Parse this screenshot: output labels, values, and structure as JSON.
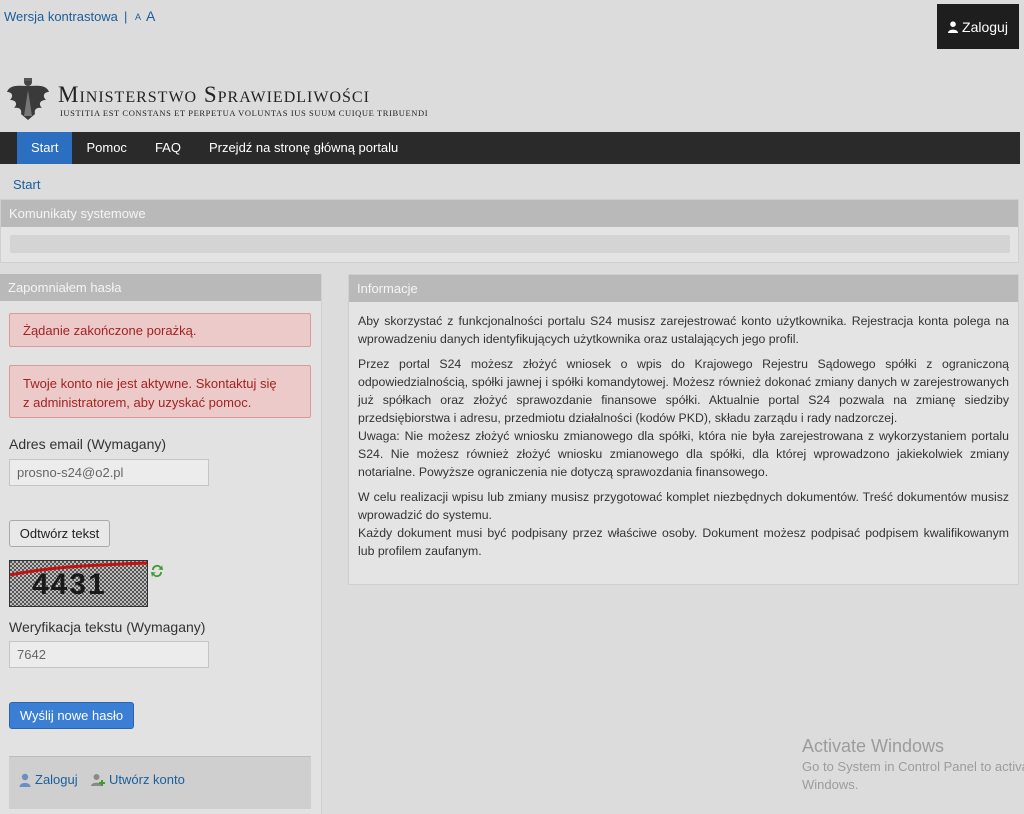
{
  "top": {
    "contrast": "Wersja kontrastowa",
    "separator": "|",
    "font_small": "A",
    "font_large": "A",
    "login": "Zaloguj"
  },
  "logo": {
    "title": "Ministerstwo Sprawiedliwości",
    "motto": "IUSTITIA EST CONSTANS ET PERPETUA VOLUNTAS IUS SUUM CUIQUE TRIBUENDI"
  },
  "nav": [
    "Start",
    "Pomoc",
    "FAQ",
    "Przejdź na stronę główną portalu"
  ],
  "breadcrumb": "Start",
  "system_panel": {
    "title": "Komunikaty systemowe"
  },
  "left_panel": {
    "title": "Zapomniałem hasła",
    "alert1": "Żądanie zakończone porażką.",
    "alert2_line1": "Twoje konto nie jest aktywne. Skontaktuj się",
    "alert2_line2": "z administratorem, aby uzyskać pomoc.",
    "email_label": "Adres email (Wymagany)",
    "email_value": "prosno-s24@o2.pl",
    "audio_button": "Odtwórz tekst",
    "captcha_label": "Weryfikacja tekstu (Wymagany)",
    "captcha_value": "7642",
    "submit": "Wyślij nowe hasło",
    "footer_login": "Zaloguj",
    "footer_register": "Utwórz konto"
  },
  "info_panel": {
    "title": "Informacje",
    "p1": "Aby skorzystać z funkcjonalności portalu S24 musisz zarejestrować konto użytkownika. Rejestracja konta polega na wprowadzeniu danych identyfikujących użytkownika oraz ustalających jego profil.",
    "p2a": "Przez portal S24 możesz złożyć wniosek o wpis do Krajowego Rejestru Sądowego spółki z ograniczoną odpowiedzialnością, spółki jawnej i spółki komandytowej. Możesz również dokonać zmiany danych w zarejestrowanych już spółkach oraz złożyć sprawozdanie finansowe spółki. Aktualnie portal S24 pozwala na zmianę siedziby przedsiębiorstwa i adresu, przedmiotu działalności (kodów PKD), składu zarządu i rady nadzorczej.",
    "p2b": "Uwaga: Nie możesz złożyć wniosku zmianowego dla spółki, która nie była zarejestrowana z wykorzystaniem portalu S24. Nie możesz również złożyć wniosku zmianowego dla spółki, dla której wprowadzono jakiekolwiek zmiany notarialne. Powyższe ograniczenia nie dotyczą sprawozdania finansowego.",
    "p3a": "W celu realizacji wpisu lub zmiany musisz przygotować komplet niezbędnych dokumentów. Treść dokumentów musisz wprowadzić do systemu.",
    "p3b": "Każdy dokument musi być podpisany przez właściwe osoby. Dokument możesz podpisać podpisem kwalifikowanym lub profilem zaufanym."
  },
  "watermark": {
    "line1": "Activate Windows",
    "line2": "Go to System in Control Panel to activate",
    "line3": "Windows."
  }
}
